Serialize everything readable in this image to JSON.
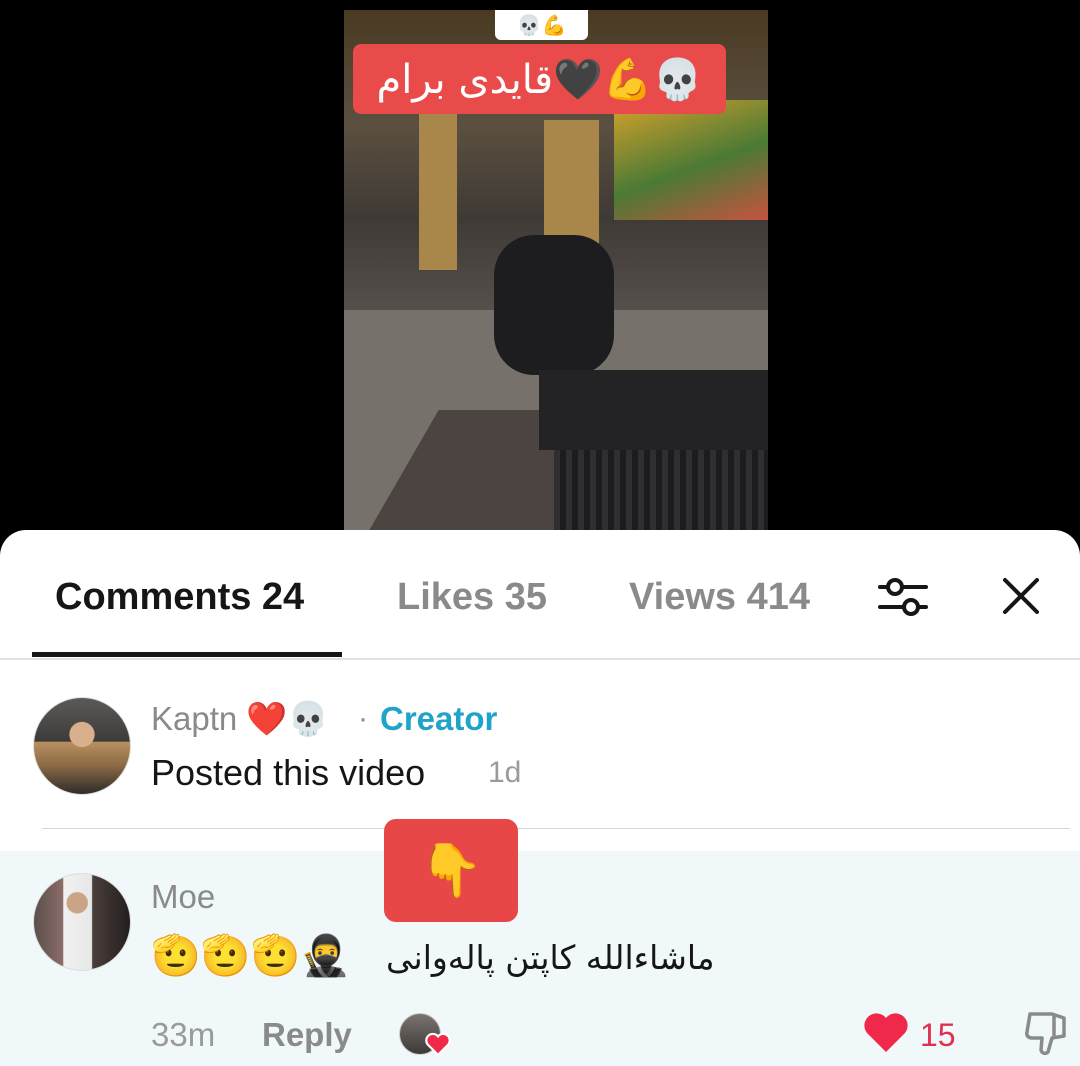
{
  "video": {
    "caption_top_emoji": "💀💪",
    "caption_text": "قایدی برام🖤💪💀"
  },
  "tabs": [
    {
      "label": "Comments 24",
      "active": true
    },
    {
      "label": "Likes 35",
      "active": false
    },
    {
      "label": "Views 414",
      "active": false
    }
  ],
  "icons": {
    "filter": "filter-sliders-icon",
    "close": "close-icon"
  },
  "comments": [
    {
      "username": "Kaptn ❤️💀",
      "separator": "·",
      "badge": "Creator",
      "text": "Posted this video",
      "time": "1d"
    },
    {
      "username": "Moe",
      "text": "ماشاءالله کاپتن پالەوانی",
      "emojis": "🫡🫡🫡🥷",
      "time": "33m",
      "reply_label": "Reply",
      "like_count": "15",
      "pointer_emoji": "👇"
    }
  ],
  "colors": {
    "accent_red": "#e94a4a",
    "creator_blue": "#1fa3c9",
    "like_red": "#e03050"
  }
}
